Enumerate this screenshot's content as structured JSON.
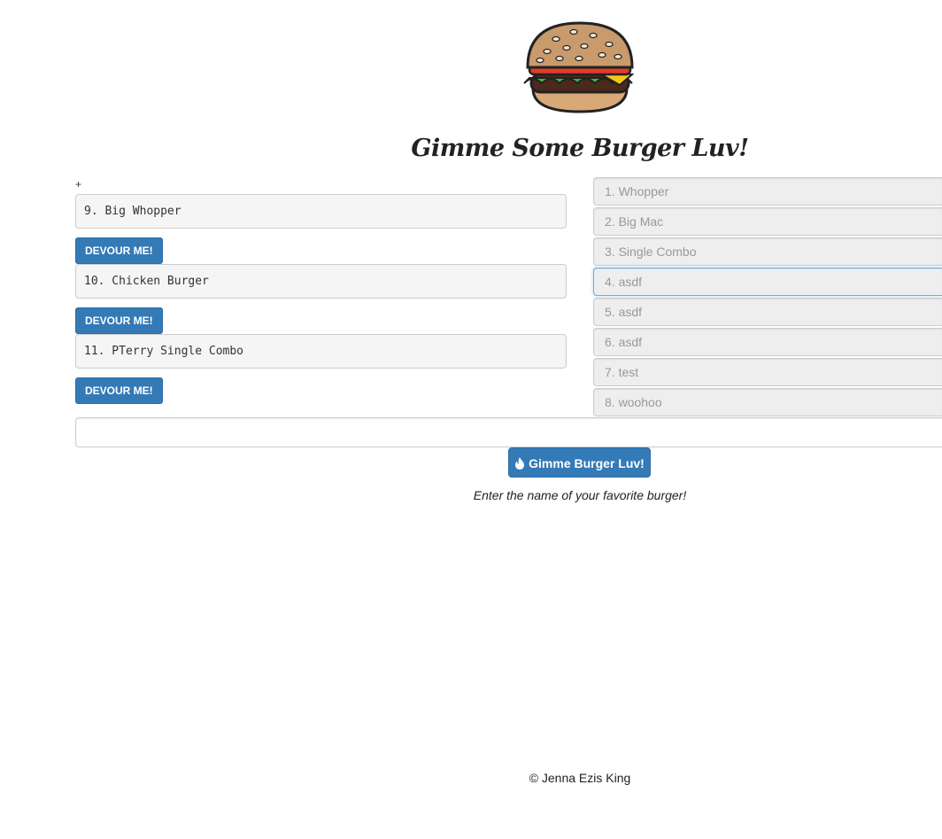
{
  "header": {
    "logo_icon": "burger-icon",
    "title": "Gimme Some Burger Luv!",
    "stray_mark": "+"
  },
  "uneaten": [
    {
      "label": "9. Big Whopper",
      "button": "DEVOUR ME!"
    },
    {
      "label": "10. Chicken Burger",
      "button": "DEVOUR ME!"
    },
    {
      "label": "11. PTerry Single Combo",
      "button": "DEVOUR ME!"
    }
  ],
  "devoured": [
    "1. Whopper",
    "2. Big Mac",
    "3. Single Combo",
    "4. asdf",
    "5. asdf",
    "6. asdf",
    "7. test",
    "8. woohoo"
  ],
  "form": {
    "input_value": "",
    "submit_label": "Gimme Burger Luv!",
    "submit_icon": "flame-icon",
    "helper_text": "Enter the name of your favorite burger!"
  },
  "footer": {
    "copyright": "© Jenna Ezis King"
  },
  "colors": {
    "primary": "#337ab7",
    "focus": "#66afe9"
  }
}
